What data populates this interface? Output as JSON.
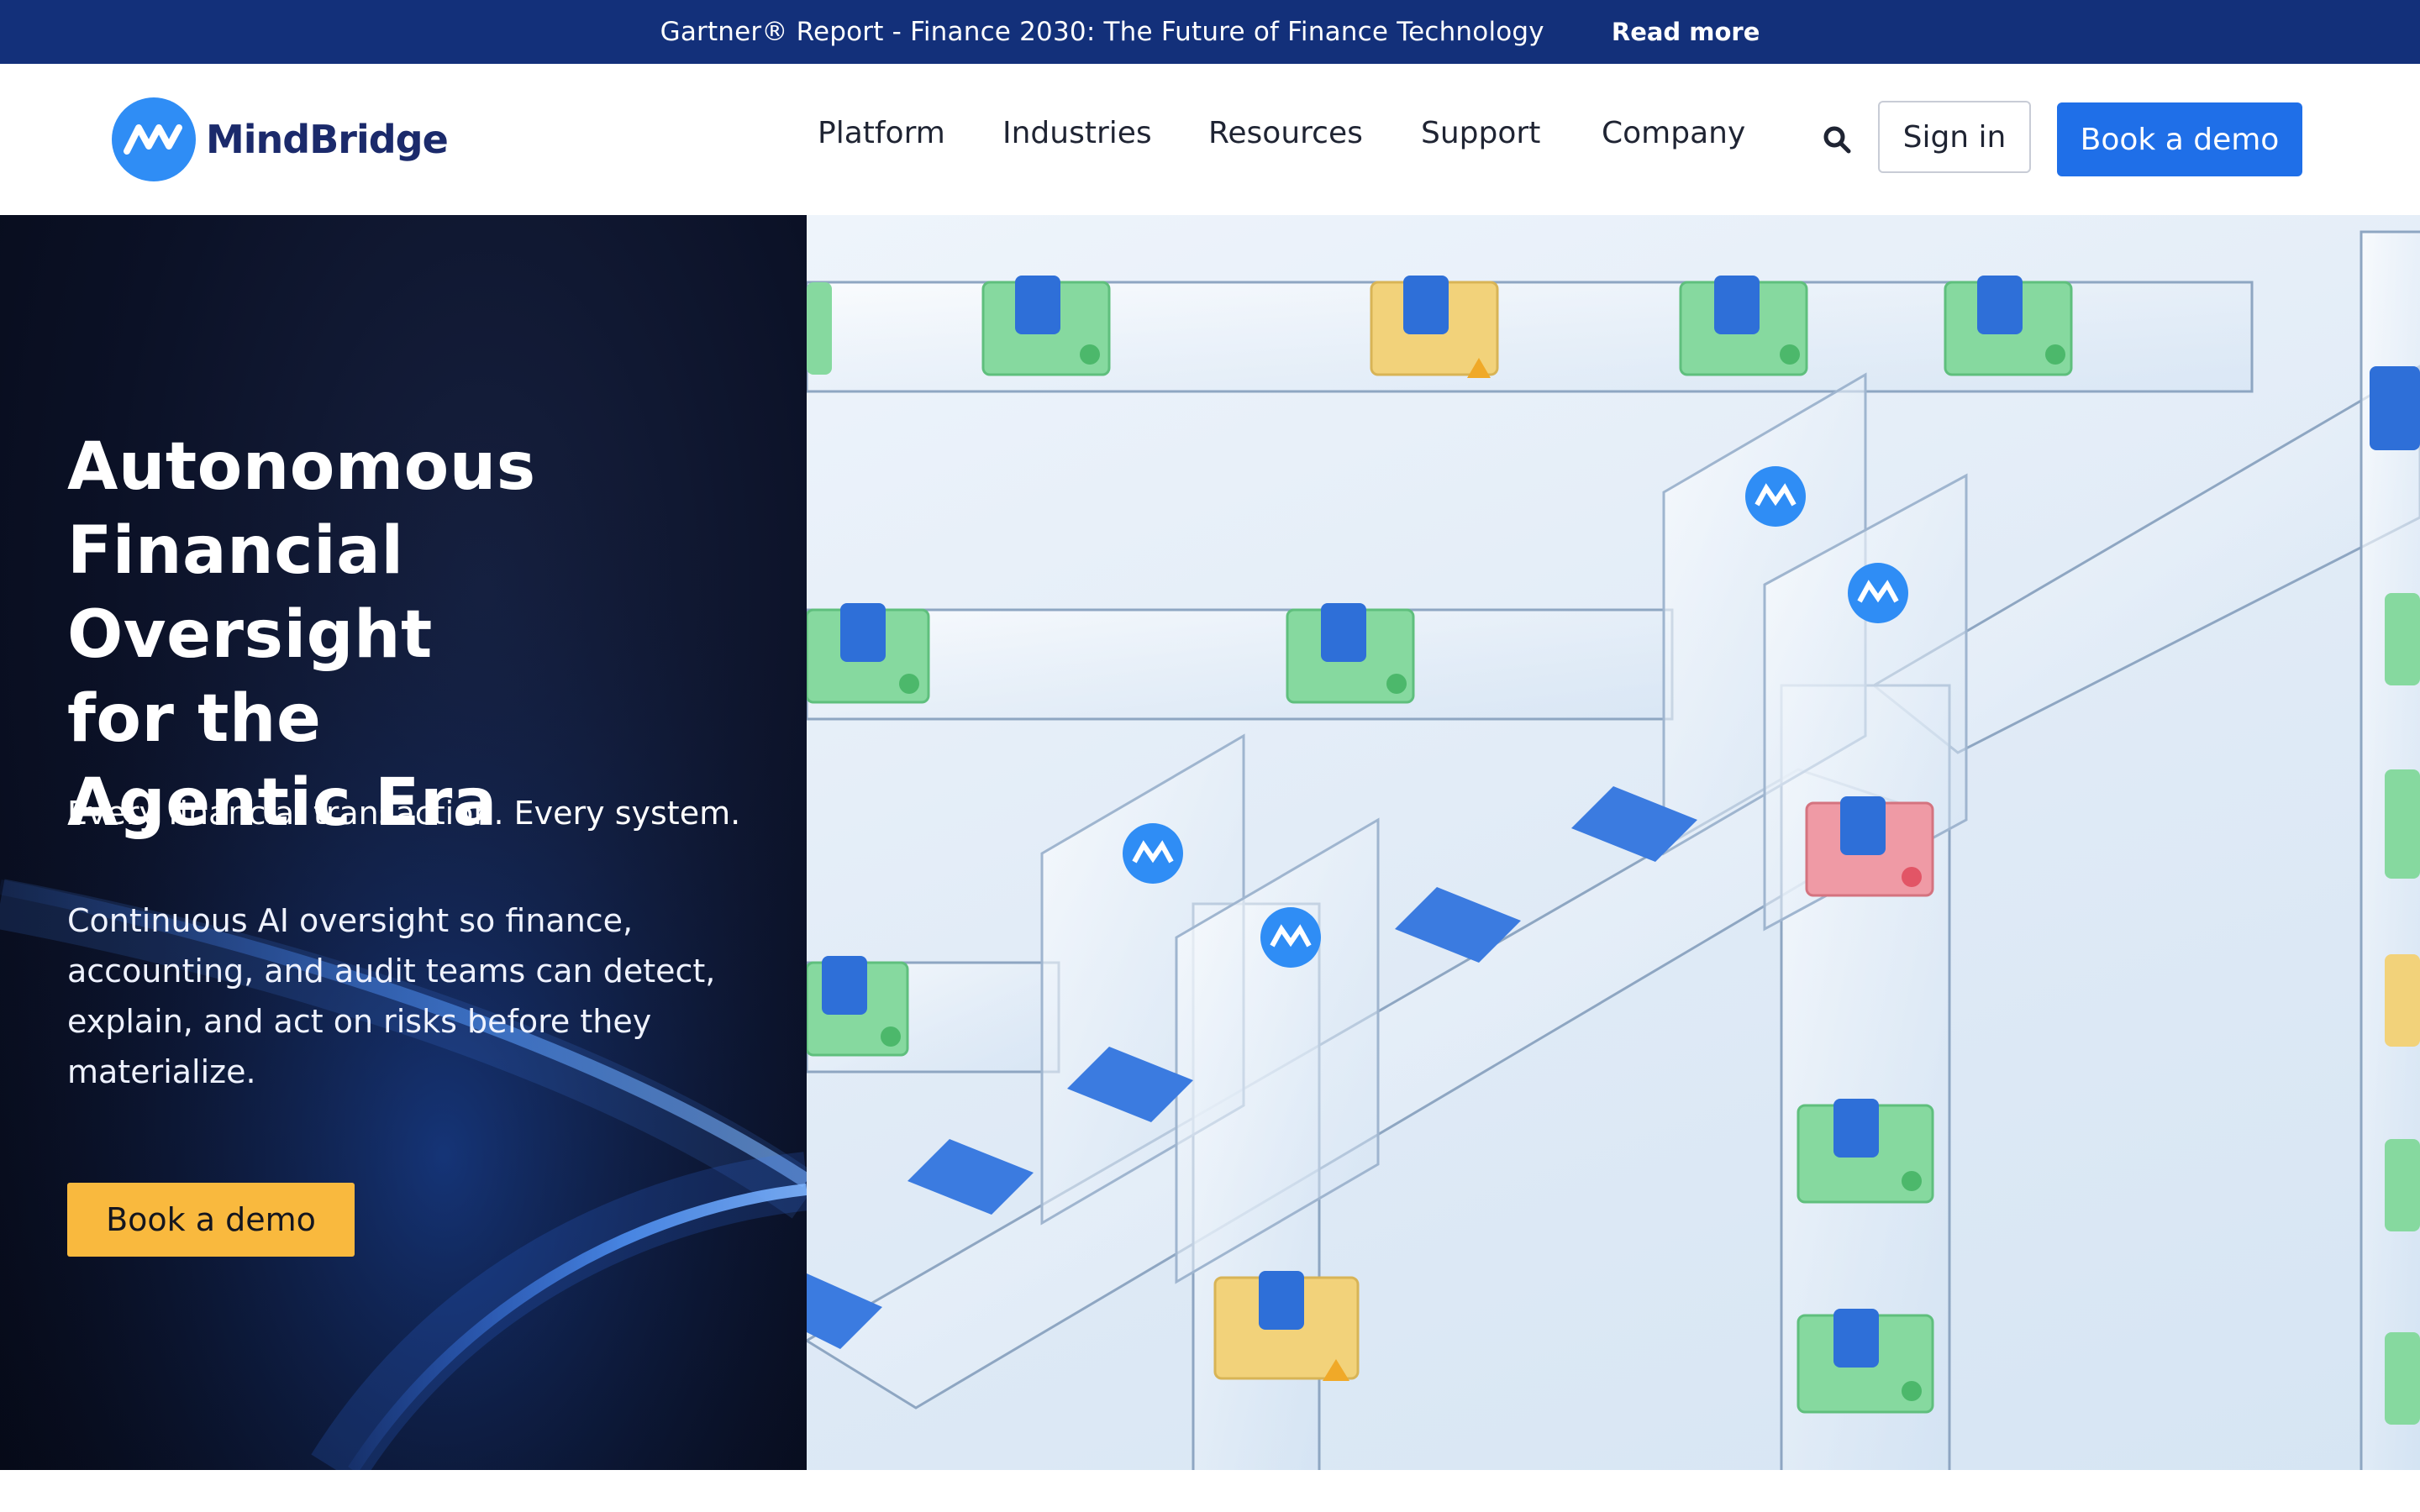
{
  "announcement": {
    "message": "Gartner® Report - Finance 2030: The Future of Finance Technology",
    "link_label": "Read more"
  },
  "header": {
    "brand": "MindBridge",
    "nav": [
      "Platform",
      "Industries",
      "Resources",
      "Support",
      "Company"
    ],
    "search_icon": "search-icon",
    "sign_in_label": "Sign in",
    "demo_label": "Book a demo"
  },
  "hero": {
    "title_lines": [
      "Autonomous",
      "Financial Oversight",
      "for the",
      "Agentic Era"
    ],
    "subtitle": "Every financial transaction. Every system.",
    "body": "Continuous AI oversight so finance, accounting, and audit teams can detect, explain, and act on risks before they materialize.",
    "cta_label": "Book a demo"
  },
  "colors": {
    "announcement_bg": "#13307a",
    "brand_blue": "#1f6fe8",
    "brand_navy": "#1b2a6b",
    "cta_yellow": "#f9b93e",
    "hero_dark": "#0b1126",
    "status_green": "#7fd69a",
    "status_yellow": "#f2d27a",
    "status_red": "#ef9aa5"
  }
}
